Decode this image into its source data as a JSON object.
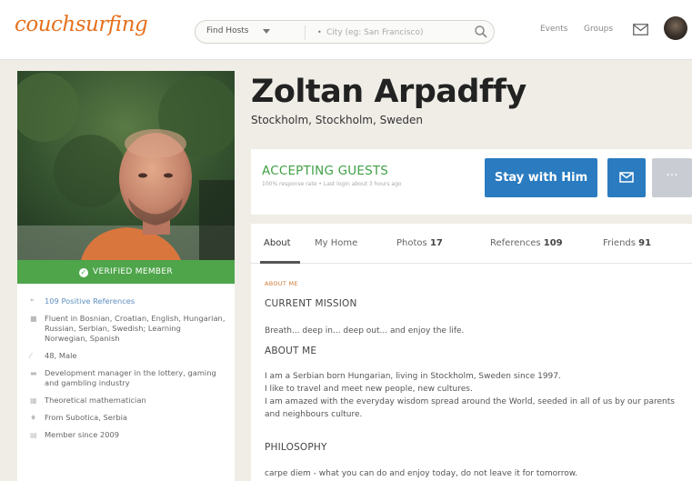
{
  "nav": {
    "logo": "couchsurfing",
    "find_hosts": "Find Hosts",
    "city_placeholder": "City (eg: San Francisco)",
    "events": "Events",
    "groups": "Groups"
  },
  "profile": {
    "name": "Zoltan Arpadffy",
    "location": "Stockholm, Stockholm, Sweden",
    "verified": "VERIFIED MEMBER",
    "facts": [
      {
        "icon": "quote-icon",
        "text": "109 Positive References"
      },
      {
        "icon": "speech-icon",
        "text": "Fluent in Bosnian, Croatian, English, Hungarian, Russian, Serbian, Swedish; Learning Norwegian, Spanish"
      },
      {
        "icon": "gender-icon",
        "text": "48, Male"
      },
      {
        "icon": "briefcase-icon",
        "text": "Development manager in the lottery, gaming and gambling industry"
      },
      {
        "icon": "education-icon",
        "text": "Theoretical mathematician"
      },
      {
        "icon": "pin-icon",
        "text": "From Subotica, Serbia"
      },
      {
        "icon": "member-icon",
        "text": "Member since 2009"
      }
    ]
  },
  "status": {
    "accepting": "ACCEPTING GUESTS",
    "response_rate": "100% response rate • Last login about 3 hours ago",
    "stay_button": "Stay with Him",
    "more_button": "···"
  },
  "tabs": [
    {
      "label": "About",
      "count": ""
    },
    {
      "label": "My Home",
      "count": ""
    },
    {
      "label": "Photos",
      "count": "17"
    },
    {
      "label": "References",
      "count": "109"
    },
    {
      "label": "Friends",
      "count": "91"
    }
  ],
  "about": {
    "section_label": "ABOUT ME",
    "mission_heading": "CURRENT MISSION",
    "mission_text": "Breath... deep in... deep out... and enjoy the life.",
    "aboutme_heading": "ABOUT ME",
    "aboutme_lines": [
      "I am a Serbian born Hungarian, living in Stockholm, Sweden since 1997.",
      "I like to travel and meet new people, new cultures.",
      "I am amazed with the everyday wisdom spread around the World, seeded in all of us by our parents and neighbours culture."
    ],
    "philosophy_heading": "PHILOSOPHY",
    "philosophy_text": "carpe diem - what you can do and enjoy today, do not leave it for tomorrow."
  },
  "colors": {
    "accent_orange": "#e5711f",
    "accept_green": "#42a046",
    "verified_green": "#4ea54a",
    "button_blue": "#2a7bbf",
    "background": "#efede6"
  }
}
